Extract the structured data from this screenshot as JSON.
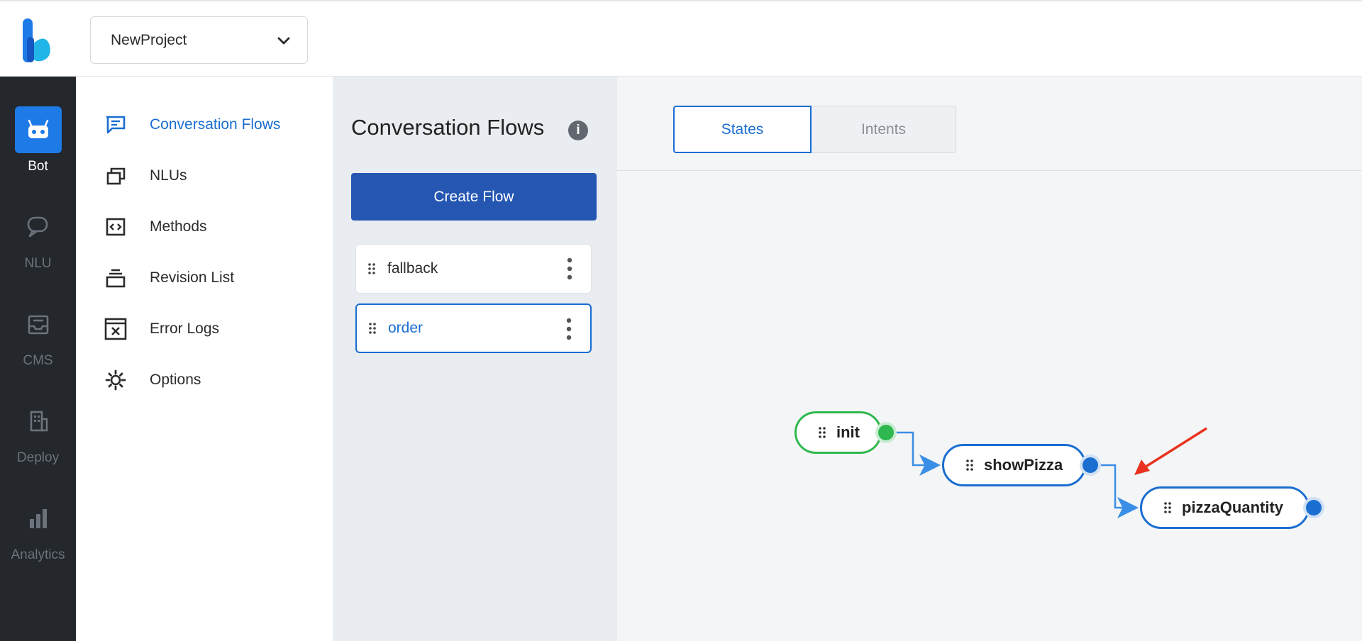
{
  "header": {
    "project_name": "NewProject",
    "logo_icon": "k-logo-icon",
    "dropdown_icon": "chevron-down-icon"
  },
  "rail": {
    "items": [
      {
        "label": "Bot",
        "icon": "robot-icon",
        "active": true
      },
      {
        "label": "NLU",
        "icon": "chat-bubble-icon",
        "active": false
      },
      {
        "label": "CMS",
        "icon": "inbox-icon",
        "active": false
      },
      {
        "label": "Deploy",
        "icon": "building-icon",
        "active": false
      },
      {
        "label": "Analytics",
        "icon": "bar-chart-icon",
        "active": false
      }
    ]
  },
  "subnav": {
    "items": [
      {
        "label": "Conversation Flows",
        "icon": "message-square-icon",
        "active": true
      },
      {
        "label": "NLUs",
        "icon": "copy-stack-icon",
        "active": false
      },
      {
        "label": "Methods",
        "icon": "code-icon",
        "active": false
      },
      {
        "label": "Revision List",
        "icon": "layers-icon",
        "active": false
      },
      {
        "label": "Error Logs",
        "icon": "error-window-icon",
        "active": false
      },
      {
        "label": "Options",
        "icon": "gear-icon",
        "active": false
      }
    ]
  },
  "flows_panel": {
    "title": "Conversation Flows",
    "info_symbol": "i",
    "create_label": "Create Flow",
    "flows": [
      {
        "name": "fallback",
        "selected": false
      },
      {
        "name": "order",
        "selected": true
      }
    ]
  },
  "canvas": {
    "tabs": [
      {
        "label": "States",
        "active": true
      },
      {
        "label": "Intents",
        "active": false
      }
    ],
    "nodes": [
      {
        "label": "init",
        "color": "#2fb84f"
      },
      {
        "label": "showPizza",
        "color": "#1a6ed0"
      },
      {
        "label": "pizzaQuantity",
        "color": "#1a6ed0"
      }
    ],
    "edge_color": "#3a8ee6",
    "annotation_arrow_color": "#e8321f"
  },
  "colors": {
    "primary": "#1a6ed0",
    "button": "#2456b2",
    "rail_bg": "#24272c",
    "rail_active": "#1e7ae6",
    "init_green": "#2fb84f"
  }
}
